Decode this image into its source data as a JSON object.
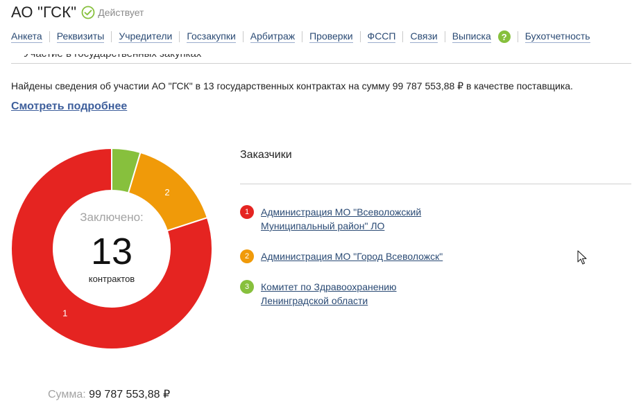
{
  "header": {
    "company_name": "АО \"ГСК\"",
    "status_text": "Действует",
    "status_color": "#87c03d"
  },
  "tabs": [
    {
      "label": "Анкета"
    },
    {
      "label": "Реквизиты"
    },
    {
      "label": "Учредители"
    },
    {
      "label": "Госзакупки"
    },
    {
      "label": "Арбитраж"
    },
    {
      "label": "Проверки"
    },
    {
      "label": "ФССП"
    },
    {
      "label": "Связи"
    },
    {
      "label": "Выписка"
    },
    {
      "label": "Бухотчетность"
    }
  ],
  "help_icon": {
    "icon": "question-icon",
    "glyph": "?"
  },
  "section": {
    "partial_heading": "Участие в государственных закупках",
    "summary": "Найдены сведения об участии АО \"ГСК\" в 13 государственных контрактах на сумму 99 787 553,88 ₽ в качестве поставщика.",
    "more_link": "Смотреть подробнее"
  },
  "donut": {
    "label_top": "Заключено:",
    "count": "13",
    "label_bottom": "контрактов"
  },
  "chart_data": {
    "type": "pie",
    "categories": [
      "1",
      "2",
      "3"
    ],
    "values": [
      10.4,
      2.0,
      0.6
    ],
    "colors": [
      "#e52421",
      "#f09a09",
      "#87c03d"
    ],
    "slice_labels": [
      "1",
      "2",
      ""
    ]
  },
  "customers": {
    "title": "Заказчики",
    "items": [
      {
        "num": "1",
        "line1": "Администрация МО \"Всеволожский",
        "line2": "Муниципальный район\" ЛО",
        "color": "#e52421"
      },
      {
        "num": "2",
        "line1": "Администрация МО \"Город Всеволожск\"",
        "line2": "",
        "color": "#f09a09"
      },
      {
        "num": "3",
        "line1": "Комитет по Здравоохранению",
        "line2": "Ленинградской области",
        "color": "#87c03d"
      }
    ]
  },
  "sum": {
    "label": "Сумма:",
    "value": "99 787 553,88 ₽"
  }
}
